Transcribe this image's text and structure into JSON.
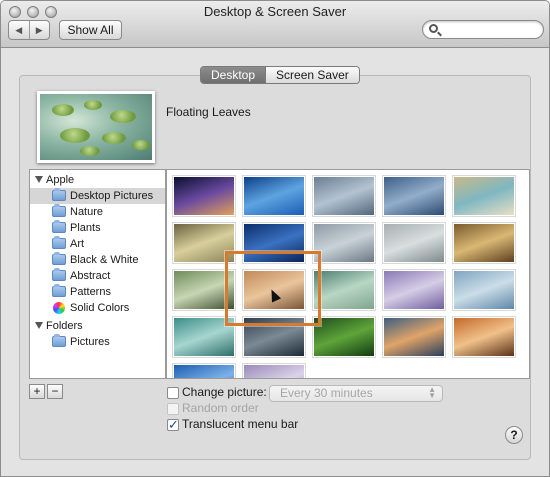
{
  "window": {
    "title": "Desktop & Screen Saver"
  },
  "toolbar": {
    "back_glyph": "◀",
    "forward_glyph": "▶",
    "show_all_label": "Show All",
    "search_placeholder": ""
  },
  "tabs": [
    {
      "label": "Desktop",
      "active": true
    },
    {
      "label": "Screen Saver",
      "active": false
    }
  ],
  "current_picture": {
    "name": "Floating Leaves"
  },
  "sidebar": {
    "apple_label": "Apple",
    "apple_items": [
      {
        "label": "Desktop Pictures",
        "selected": true,
        "icon": "folder-icon"
      },
      {
        "label": "Nature",
        "icon": "folder-icon"
      },
      {
        "label": "Plants",
        "icon": "folder-icon"
      },
      {
        "label": "Art",
        "icon": "folder-icon"
      },
      {
        "label": "Black & White",
        "icon": "folder-icon"
      },
      {
        "label": "Abstract",
        "icon": "folder-icon"
      },
      {
        "label": "Patterns",
        "icon": "folder-icon"
      },
      {
        "label": "Solid Colors",
        "icon": "color-wheel-icon"
      }
    ],
    "folders_label": "Folders",
    "folders_items": [
      {
        "label": "Pictures",
        "icon": "folder-icon"
      }
    ]
  },
  "thumbnails": [
    {
      "name": "galaxy",
      "colors": [
        "#0a1030",
        "#6a4aa0",
        "#e0a05a"
      ]
    },
    {
      "name": "blue-waves",
      "colors": [
        "#0d3f8a",
        "#5ea4e0",
        "#1a5db5"
      ]
    },
    {
      "name": "grey-blue",
      "colors": [
        "#6a7f94",
        "#b4c3d0",
        "#52677c"
      ]
    },
    {
      "name": "blue-grey-wave",
      "colors": [
        "#3e5f86",
        "#93aecb",
        "#2c4b72"
      ]
    },
    {
      "name": "beach",
      "colors": [
        "#c9b889",
        "#7fb7c2",
        "#e8dfc6"
      ]
    },
    {
      "name": "grass-field",
      "colors": [
        "#6c6240",
        "#d8cf9c",
        "#8c8458"
      ]
    },
    {
      "name": "dark-blue",
      "colors": [
        "#0c2d6b",
        "#3a72c2",
        "#0a2458"
      ]
    },
    {
      "name": "fog-lake",
      "colors": [
        "#8e9aa4",
        "#c9d2d8",
        "#6a7884"
      ]
    },
    {
      "name": "misty-trees",
      "colors": [
        "#a7afb2",
        "#d9dede",
        "#7d8a8c"
      ]
    },
    {
      "name": "desert-bird",
      "colors": [
        "#7a5a2e",
        "#d9b874",
        "#5c4020"
      ]
    },
    {
      "name": "elephant",
      "colors": [
        "#6f8b5a",
        "#c7d6b4",
        "#3d4f30"
      ]
    },
    {
      "name": "flamingos",
      "colors": [
        "#c08a5a",
        "#eac59c",
        "#7a5638"
      ]
    },
    {
      "name": "floating-leaves",
      "colors": [
        "#4c7d71",
        "#b8d7c4",
        "#7fa48d"
      ]
    },
    {
      "name": "lavender",
      "colors": [
        "#8a7ab5",
        "#d6cde6",
        "#6f5f9e"
      ]
    },
    {
      "name": "ice-blue",
      "colors": [
        "#7fa5c0",
        "#cbdde8",
        "#5e88a8"
      ]
    },
    {
      "name": "teal",
      "colors": [
        "#3d8d8a",
        "#a7d6cf",
        "#2d6e6c"
      ]
    },
    {
      "name": "dark-water",
      "colors": [
        "#2f3f4f",
        "#7c8a94",
        "#1c2a36"
      ]
    },
    {
      "name": "green-grass",
      "colors": [
        "#1f4d1c",
        "#5ea53a",
        "#123a10"
      ]
    },
    {
      "name": "lake-sunset",
      "colors": [
        "#3d5f80",
        "#e0a469",
        "#2a3e5c"
      ]
    },
    {
      "name": "sunset-island",
      "colors": [
        "#c46a2c",
        "#f0c18a",
        "#5a3018"
      ]
    },
    {
      "name": "blue-swirl",
      "colors": [
        "#1d5db0",
        "#7cb2e8",
        "#154a90"
      ]
    },
    {
      "name": "lavender-swirl",
      "colors": [
        "#9a8ab8",
        "#dcd3ea",
        "#7a6aa0"
      ]
    }
  ],
  "options": {
    "change_picture_label": "Change picture:",
    "change_picture_checked": false,
    "interval_value": "Every 30 minutes",
    "random_order_label": "Random order",
    "random_order_checked": false,
    "translucent_label": "Translucent menu bar",
    "translucent_checked": true
  },
  "footer": {
    "add_label": "+",
    "remove_label": "−",
    "help_label": "?"
  }
}
